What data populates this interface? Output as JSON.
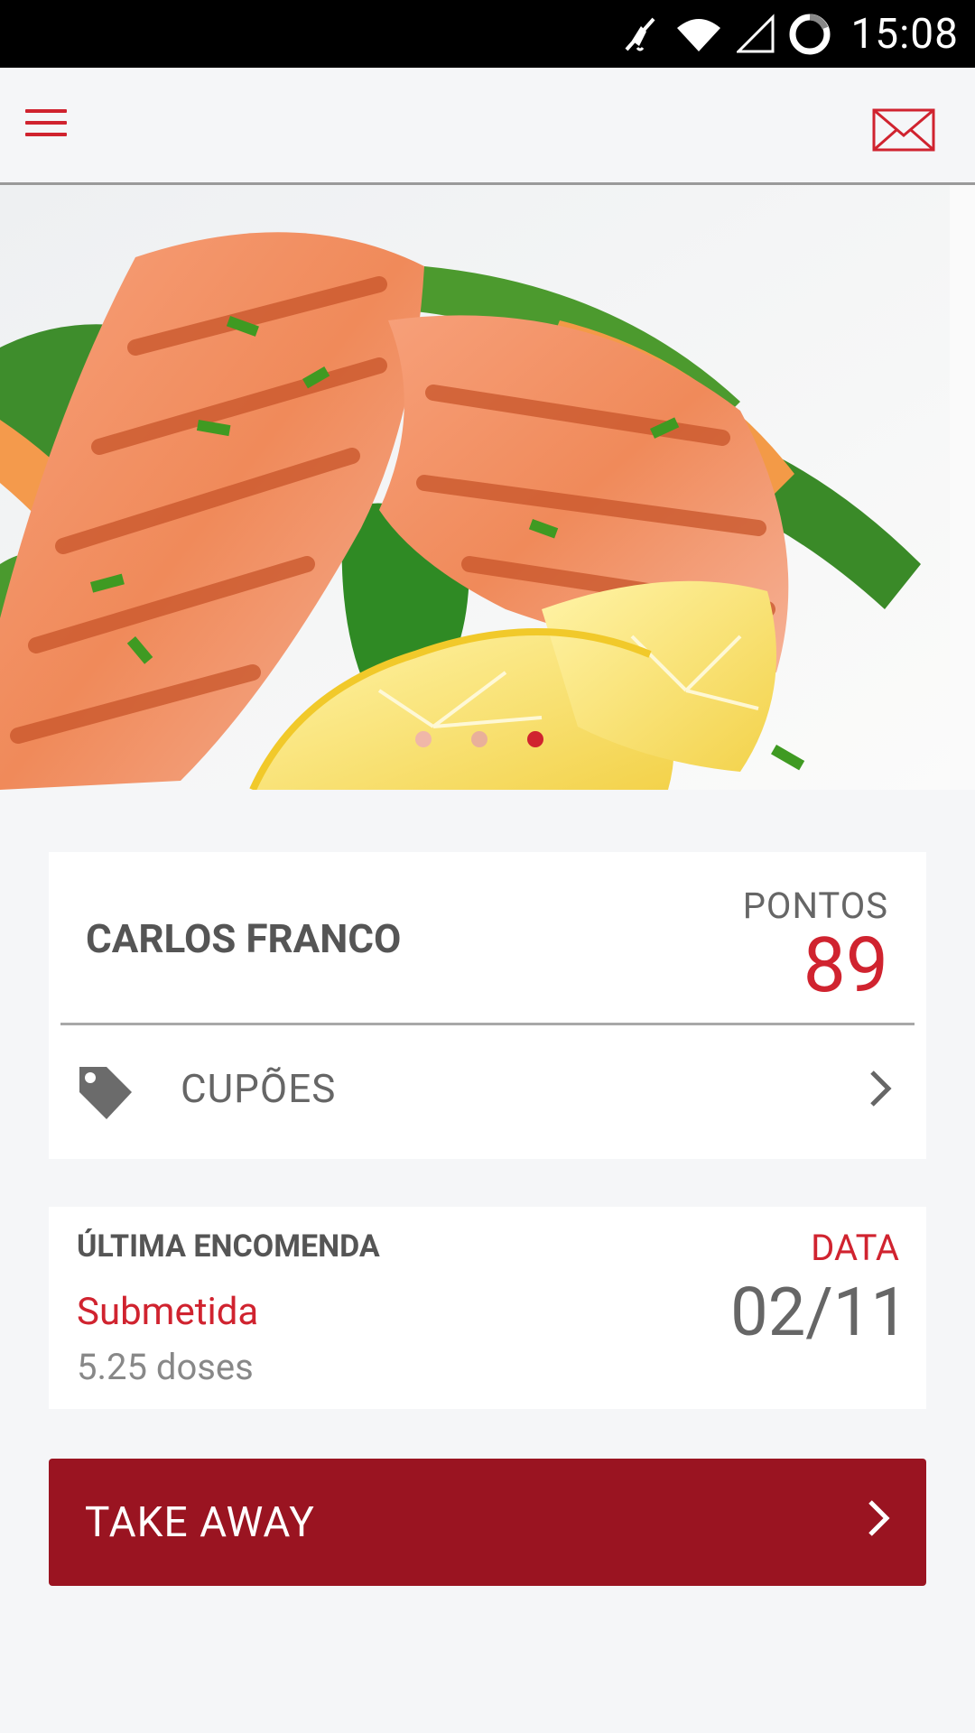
{
  "status_bar": {
    "time": "15:08",
    "icons": [
      "mute-icon",
      "wifi-icon",
      "signal-icon",
      "sync-icon"
    ]
  },
  "app_bar": {
    "menu_icon": "hamburger-menu-icon",
    "mail_icon": "envelope-icon"
  },
  "hero": {
    "image": "grilled salmon with lemon and vegetables",
    "carousel_dots": 3,
    "active_dot": 3
  },
  "profile": {
    "name": "CARLOS FRANCO",
    "points_label": "PONTOS",
    "points_value": "89"
  },
  "coupons": {
    "label": "CUPÕES",
    "icon": "tag-icon"
  },
  "last_order": {
    "label": "ÚLTIMA ENCOMENDA",
    "status": "Submetida",
    "doses": "5.25 doses",
    "date_label": "DATA",
    "date_value": "02/11"
  },
  "take_away": {
    "label": "TAKE AWAY"
  },
  "colors": {
    "accent": "#d0232f",
    "button_bg": "#9a1421",
    "background": "#f5f6f8"
  }
}
